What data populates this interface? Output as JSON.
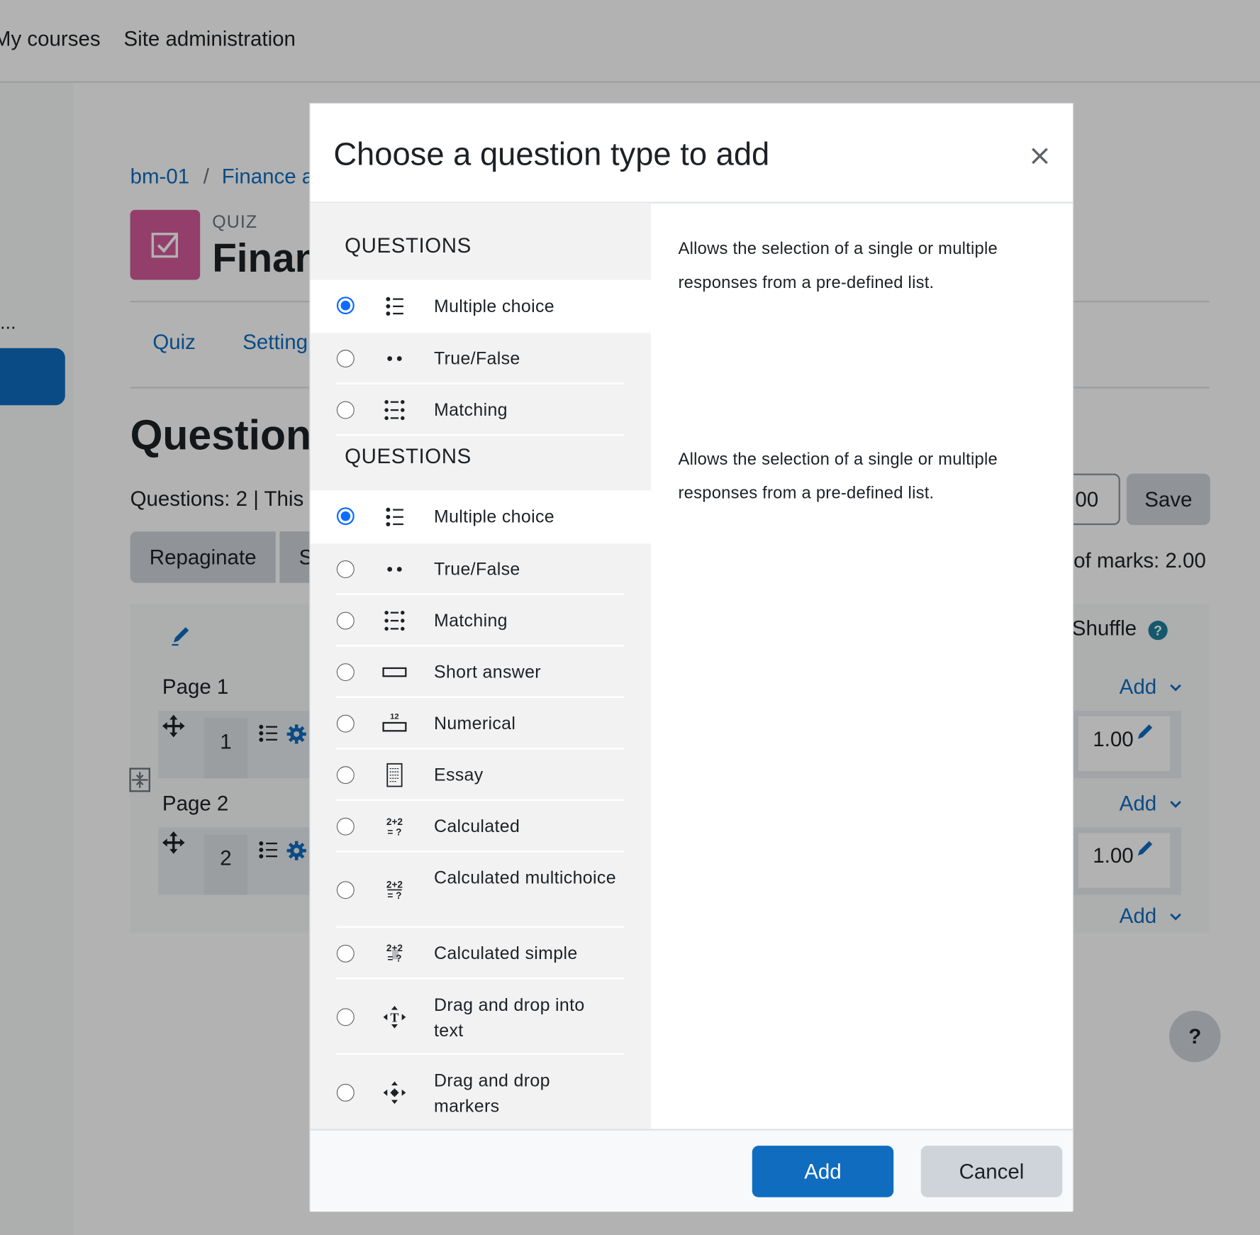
{
  "nav": {
    "items": [
      "My courses",
      "Site administration"
    ]
  },
  "sidebar": {
    "ellipsis": "..."
  },
  "breadcrumb": [
    "bm-01",
    "/",
    "Finance a"
  ],
  "quiz": {
    "label": "QUIZ",
    "title": "Finan"
  },
  "tabs": [
    "Quiz",
    "Setting"
  ],
  "main": {
    "heading": "Question",
    "info": "Questions: 2 | This",
    "repaginate": "Repaginate",
    "select_partial": "S",
    "maxgrade_partial": "00",
    "save": "Save",
    "total_marks": "of marks: 2.00",
    "shuffle": "Shuffle",
    "pages": [
      {
        "label": "Page 1",
        "slot_number": "1",
        "mark": "1.00",
        "add": "Add"
      },
      {
        "label": "Page 2",
        "slot_number": "2",
        "mark": "1.00",
        "add": "Add"
      }
    ],
    "final_add": "Add",
    "help_fab": "?"
  },
  "modal": {
    "title": "Choose a question type to add",
    "sections": [
      {
        "heading": "QUESTIONS",
        "description": "Allows the selection of a single or multiple responses from a pre-defined list.",
        "options": [
          {
            "label": "Multiple choice",
            "icon": "multichoice-icon",
            "selected": true
          },
          {
            "label": "True/False",
            "icon": "truefalse-icon",
            "selected": false
          },
          {
            "label": "Matching",
            "icon": "matching-icon",
            "selected": false
          }
        ]
      },
      {
        "heading": "QUESTIONS",
        "description": "Allows the selection of a single or multiple responses from a pre-defined list.",
        "options": [
          {
            "label": "Multiple choice",
            "icon": "multichoice-icon",
            "selected": true
          },
          {
            "label": "True/False",
            "icon": "truefalse-icon",
            "selected": false
          },
          {
            "label": "Matching",
            "icon": "matching-icon",
            "selected": false
          },
          {
            "label": "Short answer",
            "icon": "shortanswer-icon",
            "selected": false
          },
          {
            "label": "Numerical",
            "icon": "numerical-icon",
            "selected": false
          },
          {
            "label": "Essay",
            "icon": "essay-icon",
            "selected": false
          },
          {
            "label": "Calculated",
            "icon": "calculated-icon",
            "selected": false
          },
          {
            "label": "Calculated multichoice",
            "icon": "calculated-multichoice-icon",
            "selected": false
          },
          {
            "label": "Calculated simple",
            "icon": "calculated-simple-icon",
            "selected": false
          },
          {
            "label": "Drag and drop into text",
            "icon": "ddwtos-icon",
            "selected": false
          },
          {
            "label": "Drag and drop markers",
            "icon": "ddmarker-icon",
            "selected": false
          }
        ]
      }
    ],
    "add_button": "Add",
    "cancel_button": "Cancel"
  },
  "colors": {
    "primary": "#0f6cbf",
    "radio_selected": "#0f6cff",
    "quiz_icon": "#d35a9a",
    "backdrop": "rgba(0,0,0,0.30)"
  }
}
